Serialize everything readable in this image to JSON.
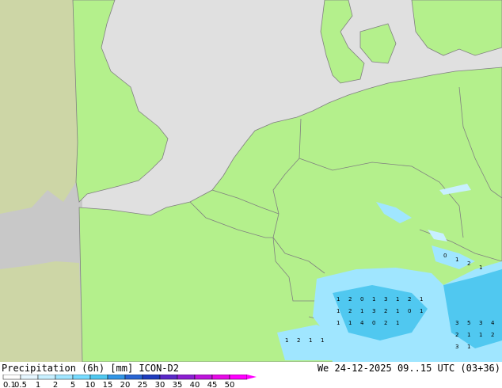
{
  "header": {
    "product": "Precipitation (6h) [mm] ICON-D2",
    "valid_time": "We 24-12-2025 09..15 UTC (03+36)"
  },
  "legend": {
    "ticks": [
      "0.1",
      "0.5",
      "1",
      "2",
      "5",
      "10",
      "15",
      "20",
      "25",
      "30",
      "35",
      "40",
      "45",
      "50"
    ],
    "colors": [
      "#ffffff",
      "#e6f7ff",
      "#c8f0ff",
      "#a0e6ff",
      "#78dcff",
      "#50c8f0",
      "#3296e6",
      "#2864d2",
      "#1e3cbe",
      "#5a28c8",
      "#8c1ed2",
      "#be14dc",
      "#e60ae6",
      "#ff00ff"
    ]
  },
  "colors": {
    "land": "#b4f08c",
    "sea": "#e0e0e0",
    "outside_domain": "#c8c8c8",
    "outside_land": "#cdd6a6",
    "border": "#808080",
    "precip_light": "#a0e6ff",
    "precip_medium": "#50c8f0"
  },
  "cells": {
    "c1": "1",
    "c2": "2",
    "c3": "0",
    "c4": "1",
    "c5": "3",
    "c6": "1",
    "c7": "2",
    "c8": "1",
    "c9": "1",
    "c10": "2",
    "c11": "1",
    "c12": "3",
    "c13": "2",
    "c14": "1",
    "c15": "0",
    "c16": "1",
    "c17": "1",
    "c18": "1",
    "c19": "4",
    "c20": "0",
    "c21": "2",
    "c22": "1",
    "c23": "3",
    "c24": "5",
    "c25": "3",
    "c26": "4",
    "c27": "2",
    "c28": "1",
    "c29": "1",
    "c30": "2",
    "c31": "3",
    "c32": "1",
    "c33": "1",
    "c34": "2",
    "c35": "1",
    "c36": "1",
    "c37": "0",
    "c38": "1",
    "c39": "2",
    "c40": "1"
  }
}
